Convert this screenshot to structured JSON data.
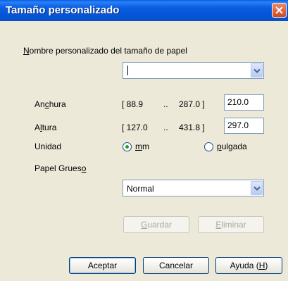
{
  "window": {
    "title": "Tamaño personalizado"
  },
  "form": {
    "name_label_prefix": "",
    "name_label_ul": "N",
    "name_label_rest": "ombre personalizado del tamaño de papel",
    "name_value": "",
    "width": {
      "label_pre": "An",
      "label_ul": "c",
      "label_post": "hura",
      "range_open": "[ 88.9",
      "range_sep": "..",
      "range_close": "287.0 ]",
      "value": "210.0"
    },
    "height": {
      "label_pre": "A",
      "label_ul": "l",
      "label_post": "tura",
      "range_open": "[ 127.0",
      "range_sep": "..",
      "range_close": "431.8 ]",
      "value": "297.0"
    },
    "unit": {
      "label": "Unidad",
      "opt_mm_ul": "m",
      "opt_mm_rest": "m",
      "opt_inch_ul": "p",
      "opt_inch_rest": "ulgada",
      "selected": "mm"
    },
    "thick_paper": {
      "label_pre": "Papel Grues",
      "label_ul": "o",
      "value": "Normal"
    }
  },
  "buttons": {
    "save_ul": "G",
    "save_rest": "uardar",
    "delete_ul": "E",
    "delete_rest": "liminar",
    "accept": "Aceptar",
    "cancel": "Cancelar",
    "help_pre": "Ayuda (",
    "help_ul": "H",
    "help_post": ")"
  }
}
